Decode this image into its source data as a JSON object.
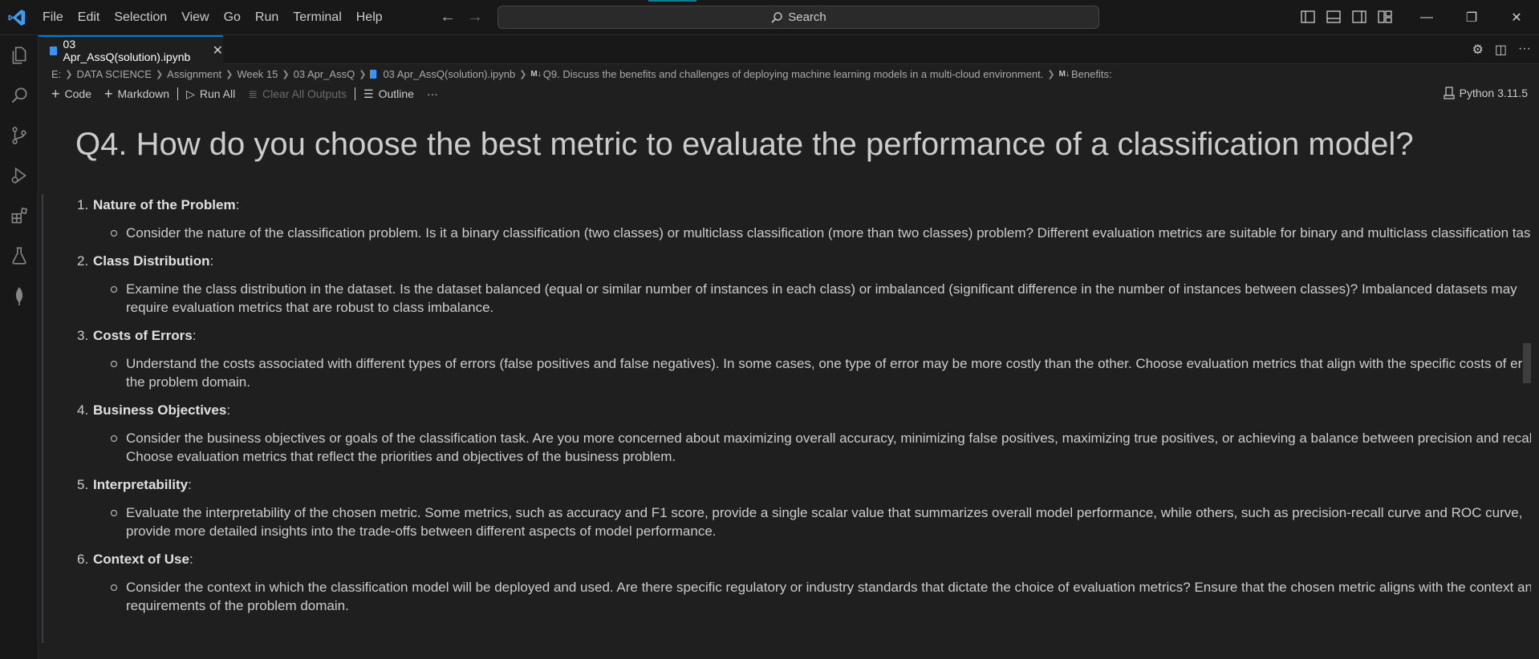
{
  "menu": [
    "File",
    "Edit",
    "Selection",
    "View",
    "Go",
    "Run",
    "Terminal",
    "Help"
  ],
  "search": {
    "label": "Search"
  },
  "tab": {
    "title": "03 Apr_AssQ(solution).ipynb",
    "close": "✕"
  },
  "breadcrumb": {
    "items": [
      "E:",
      "DATA SCIENCE",
      "Assignment",
      "Week 15",
      "03 Apr_AssQ",
      "03 Apr_AssQ(solution).ipynb",
      "Q9. Discuss the benefits and challenges of deploying machine learning models in a multi-cloud environment.",
      "Benefits:"
    ],
    "md_badge": "M↓"
  },
  "toolbar": {
    "code": "Code",
    "markdown": "Markdown",
    "run_all": "Run All",
    "clear_outputs": "Clear All Outputs",
    "outline": "Outline",
    "more": "···"
  },
  "kernel": "Python 3.11.5",
  "content": {
    "heading": "Q4. How do you choose the best metric to evaluate the performance of a classification model?",
    "points": [
      {
        "num": "1.",
        "title": "Nature of the Problem",
        "suffix": ":",
        "detail": "Consider the nature of the classification problem. Is it a binary classification (two classes) or multiclass classification (more than two classes) problem? Different evaluation metrics are suitable for binary and multiclass classification tasks."
      },
      {
        "num": "2.",
        "title": "Class Distribution",
        "suffix": ":",
        "detail": "Examine the class distribution in the dataset. Is the dataset balanced (equal or similar number of instances in each class) or imbalanced (significant difference in the number of instances between classes)? Imbalanced datasets may require evaluation metrics that are robust to class imbalance."
      },
      {
        "num": "3.",
        "title": "Costs of Errors",
        "suffix": ":",
        "detail": "Understand the costs associated with different types of errors (false positives and false negatives). In some cases, one type of error may be more costly than the other. Choose evaluation metrics that align with the specific costs of errors in the problem domain."
      },
      {
        "num": "4.",
        "title": "Business Objectives",
        "suffix": ":",
        "detail": "Consider the business objectives or goals of the classification task. Are you more concerned about maximizing overall accuracy, minimizing false positives, maximizing true positives, or achieving a balance between precision and recall? Choose evaluation metrics that reflect the priorities and objectives of the business problem."
      },
      {
        "num": "5.",
        "title": "Interpretability",
        "suffix": ":",
        "detail": "Evaluate the interpretability of the chosen metric. Some metrics, such as accuracy and F1 score, provide a single scalar value that summarizes overall model performance, while others, such as precision-recall curve and ROC curve, provide more detailed insights into the trade-offs between different aspects of model performance."
      },
      {
        "num": "6.",
        "title": "Context of Use",
        "suffix": ":",
        "detail": "Consider the context in which the classification model will be deployed and used. Are there specific regulatory or industry standards that dictate the choice of evaluation metrics? Ensure that the chosen metric aligns with the context and requirements of the problem domain."
      }
    ]
  },
  "colors": {
    "accent": "#0078d4",
    "background": "#1f1f1f",
    "chrome": "#181818",
    "logo": "#3aa0f3"
  },
  "icons": [
    "vscode-logo",
    "back-arrow-icon",
    "forward-arrow-icon",
    "search-icon",
    "explorer-icon",
    "search-sidebar-icon",
    "source-control-icon",
    "run-debug-icon",
    "extensions-icon",
    "testing-icon",
    "leaf-icon",
    "gear-icon",
    "split-editor-icon",
    "more-actions-icon"
  ]
}
